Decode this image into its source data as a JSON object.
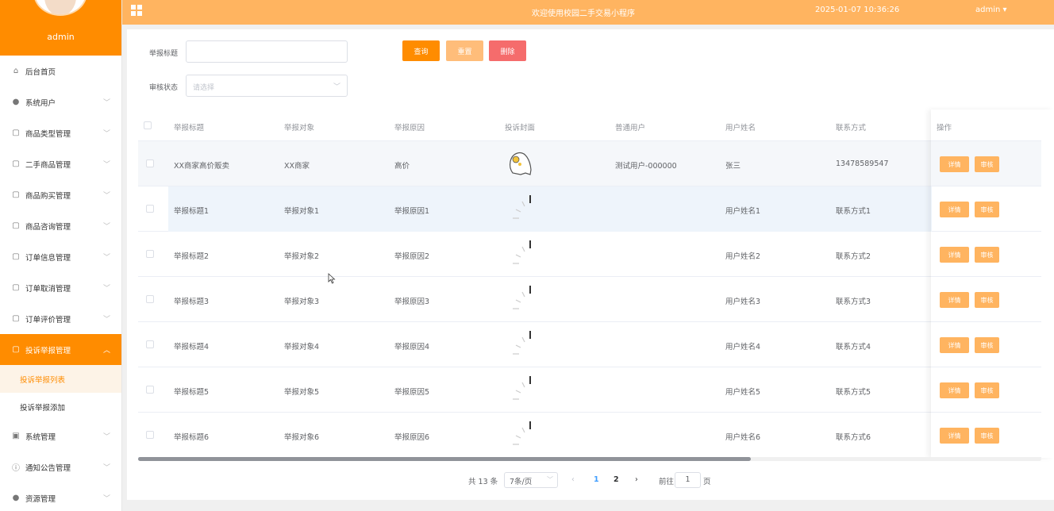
{
  "sidebar": {
    "username": "admin",
    "menu": [
      {
        "label": "后台首页",
        "icon": "home-icon"
      },
      {
        "label": "系统用户",
        "icon": "user-icon"
      },
      {
        "label": "商品类型管理",
        "icon": "doc-icon"
      },
      {
        "label": "二手商品管理",
        "icon": "doc-icon"
      },
      {
        "label": "商品购买管理",
        "icon": "doc-icon"
      },
      {
        "label": "商品咨询管理",
        "icon": "doc-icon"
      },
      {
        "label": "订单信息管理",
        "icon": "doc-icon"
      },
      {
        "label": "订单取消管理",
        "icon": "doc-icon"
      },
      {
        "label": "订单评价管理",
        "icon": "doc-icon"
      },
      {
        "label": "投诉举报管理",
        "icon": "doc-icon"
      },
      {
        "label": "系统管理",
        "icon": "image-icon"
      },
      {
        "label": "通知公告管理",
        "icon": "info-icon"
      },
      {
        "label": "资源管理",
        "icon": "location-icon"
      }
    ],
    "submenu": [
      "投诉举报列表",
      "投诉举报添加"
    ]
  },
  "topbar": {
    "title": "欢迎使用校园二手交易小程序",
    "datetime": "2025-01-07 10:36:26",
    "user": "admin"
  },
  "filters": {
    "title_label": "举报标题",
    "title_value": "",
    "status_label": "审核状态",
    "status_placeholder": "请选择"
  },
  "buttons": {
    "search": "查询",
    "reset": "重置",
    "delete": "删除"
  },
  "colors": {
    "accent": "#ff8c00",
    "topbar": "#ffb460",
    "reset": "#ffbd7a",
    "delete": "#f56c6c",
    "page_active": "#409eff"
  },
  "table": {
    "headers": [
      "举报标题",
      "举报对象",
      "举报原因",
      "投诉封面",
      "普通用户",
      "用户姓名",
      "联系方式",
      "操作"
    ],
    "rows": [
      {
        "title": "XX商家高价贩卖",
        "target": "XX商家",
        "reason": "高价",
        "user": "测试用户-000000",
        "name": "张三",
        "contact": "13478589547"
      },
      {
        "title": "举报标题1",
        "target": "举报对象1",
        "reason": "举报原因1",
        "user": "",
        "name": "用户姓名1",
        "contact": "联系方式1"
      },
      {
        "title": "举报标题2",
        "target": "举报对象2",
        "reason": "举报原因2",
        "user": "",
        "name": "用户姓名2",
        "contact": "联系方式2"
      },
      {
        "title": "举报标题3",
        "target": "举报对象3",
        "reason": "举报原因3",
        "user": "",
        "name": "用户姓名3",
        "contact": "联系方式3"
      },
      {
        "title": "举报标题4",
        "target": "举报对象4",
        "reason": "举报原因4",
        "user": "",
        "name": "用户姓名4",
        "contact": "联系方式4"
      },
      {
        "title": "举报标题5",
        "target": "举报对象5",
        "reason": "举报原因5",
        "user": "",
        "name": "用户姓名5",
        "contact": "联系方式5"
      },
      {
        "title": "举报标题6",
        "target": "举报对象6",
        "reason": "举报原因6",
        "user": "",
        "name": "用户姓名6",
        "contact": "联系方式6"
      }
    ],
    "action_detail": "详情",
    "action_audit": "审核"
  },
  "pagination": {
    "total": "共 13 条",
    "page_size": "7条/页",
    "pages": [
      "1",
      "2"
    ],
    "current": "1",
    "goto_label": "前往",
    "goto_value": "1",
    "page_unit": "页"
  }
}
